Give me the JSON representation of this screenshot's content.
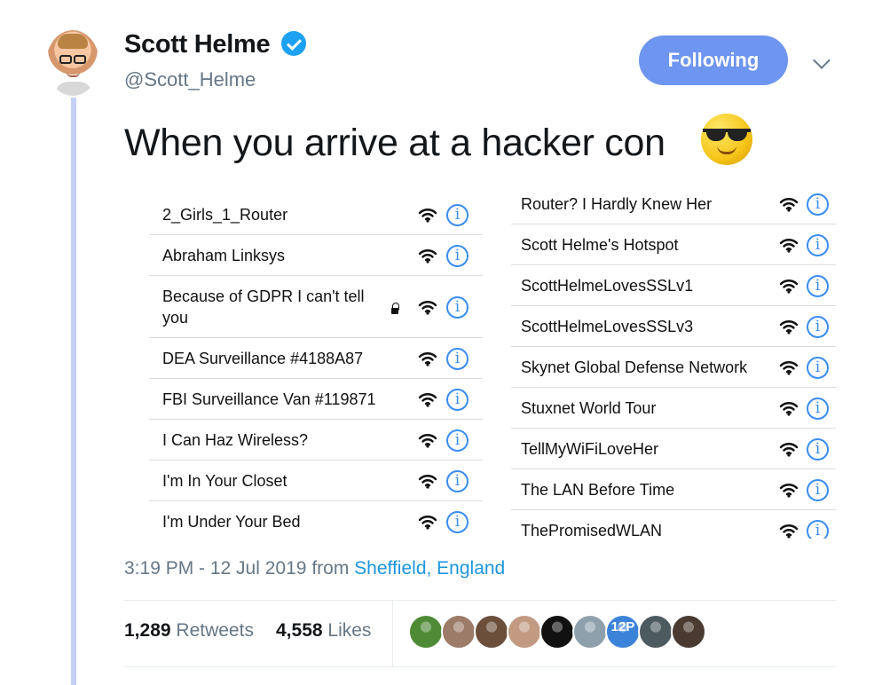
{
  "author": {
    "name": "Scott Helme",
    "handle": "@Scott_Helme",
    "verified": true,
    "avatar_icon": "profile-photo"
  },
  "actions": {
    "following_label": "Following",
    "menu_icon": "chevron-down-icon",
    "accent_color": "#6e95ef"
  },
  "tweet": {
    "text": "When you arrive at a hacker con",
    "emoji": "smiling-face-with-sunglasses"
  },
  "wifi_lists": {
    "left": [
      {
        "name": "2_Girls_1_Router",
        "secured": false
      },
      {
        "name": "Abraham Linksys",
        "secured": false
      },
      {
        "name": "Because of GDPR I can't tell you",
        "secured": true
      },
      {
        "name": "DEA Surveillance #4188A87",
        "secured": false
      },
      {
        "name": "FBI Surveillance Van #119871",
        "secured": false
      },
      {
        "name": "I Can Haz Wireless?",
        "secured": false
      },
      {
        "name": "I'm In Your Closet",
        "secured": false
      },
      {
        "name": "I'm Under Your Bed",
        "secured": false
      }
    ],
    "right": [
      {
        "name": "Router? I Hardly Knew Her",
        "secured": false
      },
      {
        "name": "Scott Helme's Hotspot",
        "secured": false
      },
      {
        "name": "ScottHelmeLovesSSLv1",
        "secured": false
      },
      {
        "name": "ScottHelmeLovesSSLv3",
        "secured": false
      },
      {
        "name": "Skynet Global Defense Network",
        "secured": false
      },
      {
        "name": "Stuxnet World Tour",
        "secured": false
      },
      {
        "name": "TellMyWiFiLoveHer",
        "secured": false
      },
      {
        "name": "The LAN Before Time",
        "secured": false
      },
      {
        "name": "ThePromisedWLAN",
        "secured": false
      }
    ],
    "info_glyph": "i",
    "info_color": "#3a8df1"
  },
  "meta": {
    "time": "3:19 PM - 12 Jul 2019",
    "from_label": "from",
    "place": "Sheffield, England"
  },
  "stats": {
    "retweets_count": "1,289",
    "retweets_label": "Retweets",
    "likes_count": "4,558",
    "likes_label": "Likes"
  },
  "likers": [
    {
      "name": "liker-1",
      "color": "#4f8b36"
    },
    {
      "name": "liker-2",
      "color": "#9c7b68"
    },
    {
      "name": "liker-3",
      "color": "#6b4f3b"
    },
    {
      "name": "liker-4",
      "color": "#c29a82"
    },
    {
      "name": "liker-5",
      "color": "#111111"
    },
    {
      "name": "liker-6",
      "color": "#8fa0ad"
    },
    {
      "name": "liker-7",
      "color": "#3b82d9",
      "label": "12P"
    },
    {
      "name": "liker-8",
      "color": "#4d5b61"
    },
    {
      "name": "liker-9",
      "color": "#4a3a31"
    }
  ]
}
